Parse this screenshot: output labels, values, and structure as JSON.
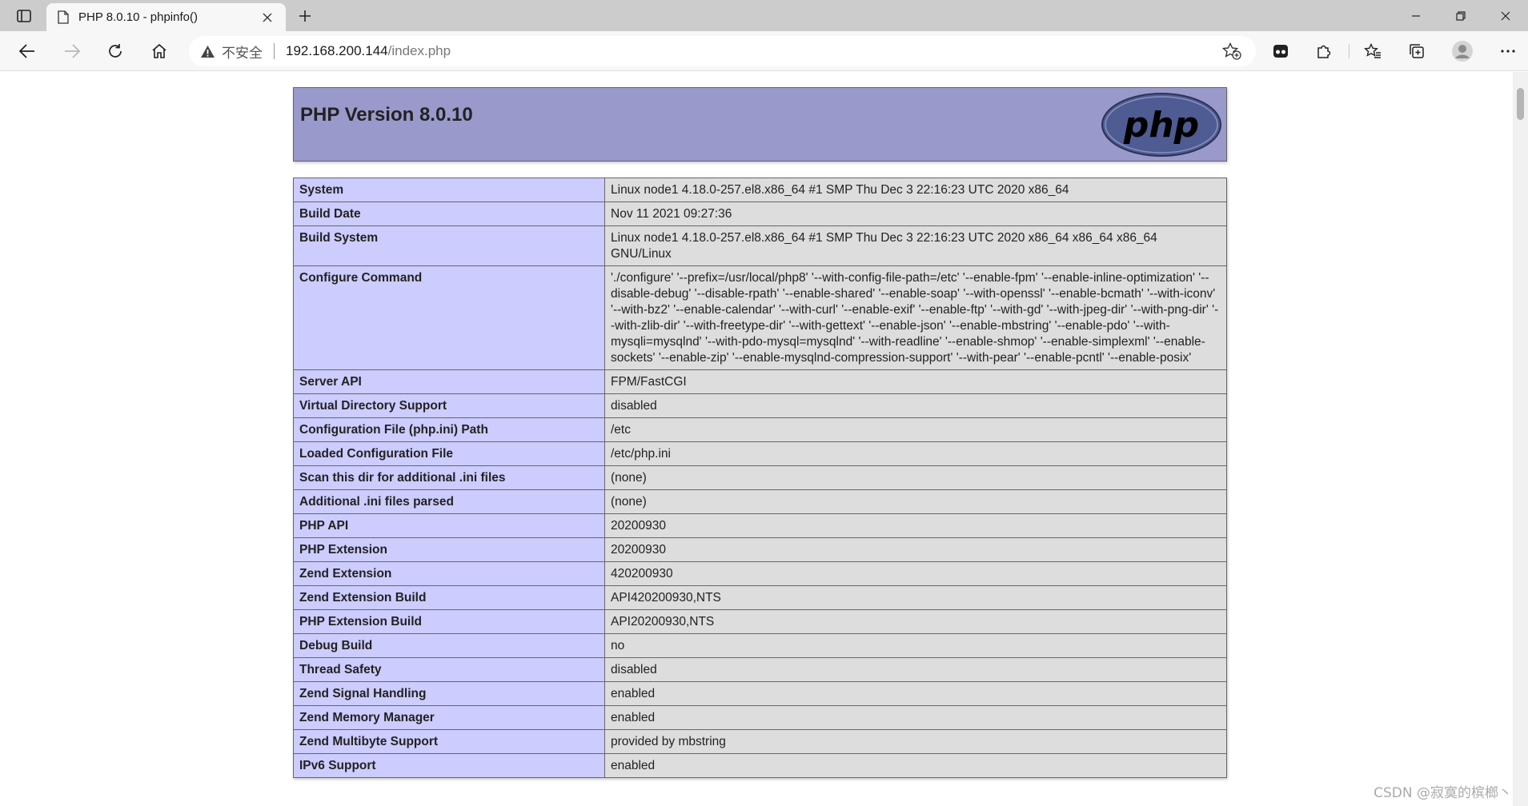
{
  "browser": {
    "tab_title": "PHP 8.0.10 - phpinfo()",
    "security_label": "不安全",
    "url_host": "192.168.200.144",
    "url_path": "/index.php"
  },
  "page": {
    "header_title": "PHP Version 8.0.10",
    "logo_text": "php",
    "rows": [
      {
        "key": "System",
        "value": "Linux node1 4.18.0-257.el8.x86_64 #1 SMP Thu Dec 3 22:16:23 UTC 2020 x86_64"
      },
      {
        "key": "Build Date",
        "value": "Nov 11 2021 09:27:36"
      },
      {
        "key": "Build System",
        "value": "Linux node1 4.18.0-257.el8.x86_64 #1 SMP Thu Dec 3 22:16:23 UTC 2020 x86_64 x86_64 x86_64 GNU/Linux"
      },
      {
        "key": "Configure Command",
        "value": "'./configure' '--prefix=/usr/local/php8' '--with-config-file-path=/etc' '--enable-fpm' '--enable-inline-optimization' '--disable-debug' '--disable-rpath' '--enable-shared' '--enable-soap' '--with-openssl' '--enable-bcmath' '--with-iconv' '--with-bz2' '--enable-calendar' '--with-curl' '--enable-exif' '--enable-ftp' '--with-gd' '--with-jpeg-dir' '--with-png-dir' '--with-zlib-dir' '--with-freetype-dir' '--with-gettext' '--enable-json' '--enable-mbstring' '--enable-pdo' '--with-mysqli=mysqlnd' '--with-pdo-mysql=mysqlnd' '--with-readline' '--enable-shmop' '--enable-simplexml' '--enable-sockets' '--enable-zip' '--enable-mysqlnd-compression-support' '--with-pear' '--enable-pcntl' '--enable-posix'"
      },
      {
        "key": "Server API",
        "value": "FPM/FastCGI"
      },
      {
        "key": "Virtual Directory Support",
        "value": "disabled"
      },
      {
        "key": "Configuration File (php.ini) Path",
        "value": "/etc"
      },
      {
        "key": "Loaded Configuration File",
        "value": "/etc/php.ini"
      },
      {
        "key": "Scan this dir for additional .ini files",
        "value": "(none)"
      },
      {
        "key": "Additional .ini files parsed",
        "value": "(none)"
      },
      {
        "key": "PHP API",
        "value": "20200930"
      },
      {
        "key": "PHP Extension",
        "value": "20200930"
      },
      {
        "key": "Zend Extension",
        "value": "420200930"
      },
      {
        "key": "Zend Extension Build",
        "value": "API420200930,NTS"
      },
      {
        "key": "PHP Extension Build",
        "value": "API20200930,NTS"
      },
      {
        "key": "Debug Build",
        "value": "no"
      },
      {
        "key": "Thread Safety",
        "value": "disabled"
      },
      {
        "key": "Zend Signal Handling",
        "value": "enabled"
      },
      {
        "key": "Zend Memory Manager",
        "value": "enabled"
      },
      {
        "key": "Zend Multibyte Support",
        "value": "provided by mbstring"
      },
      {
        "key": "IPv6 Support",
        "value": "enabled"
      }
    ]
  },
  "watermark": "CSDN @寂寞的槟榔丶",
  "colors": {
    "header_bg": "#9999cc",
    "key_bg": "#ccccff",
    "value_bg": "#dddddd"
  }
}
